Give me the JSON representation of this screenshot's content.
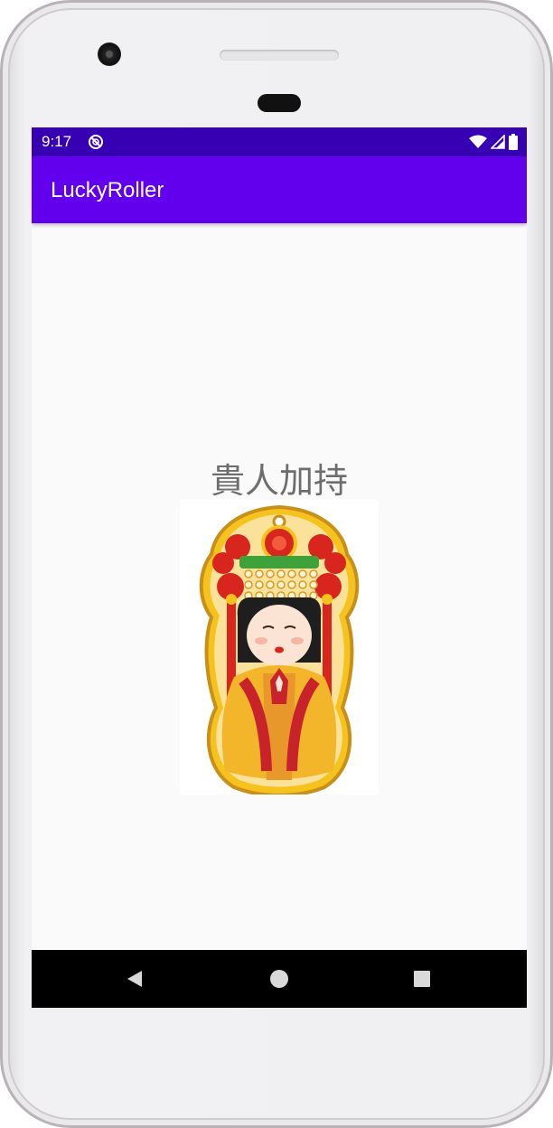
{
  "status_bar": {
    "time": "9:17",
    "icons": [
      "do-not-disturb-icon",
      "wifi-icon",
      "cell-signal-icon",
      "battery-icon"
    ]
  },
  "app_bar": {
    "title": "LuckyRoller"
  },
  "content": {
    "blessing_text": "貴人加持",
    "image": "goddess-charm-illustration"
  },
  "nav_bar": {
    "buttons": [
      "back-icon",
      "home-icon",
      "recents-icon"
    ]
  },
  "colors": {
    "status_bar": "#3700b3",
    "app_bar": "#6200ee",
    "background": "#fafafa",
    "text": "#6d6d6d"
  }
}
